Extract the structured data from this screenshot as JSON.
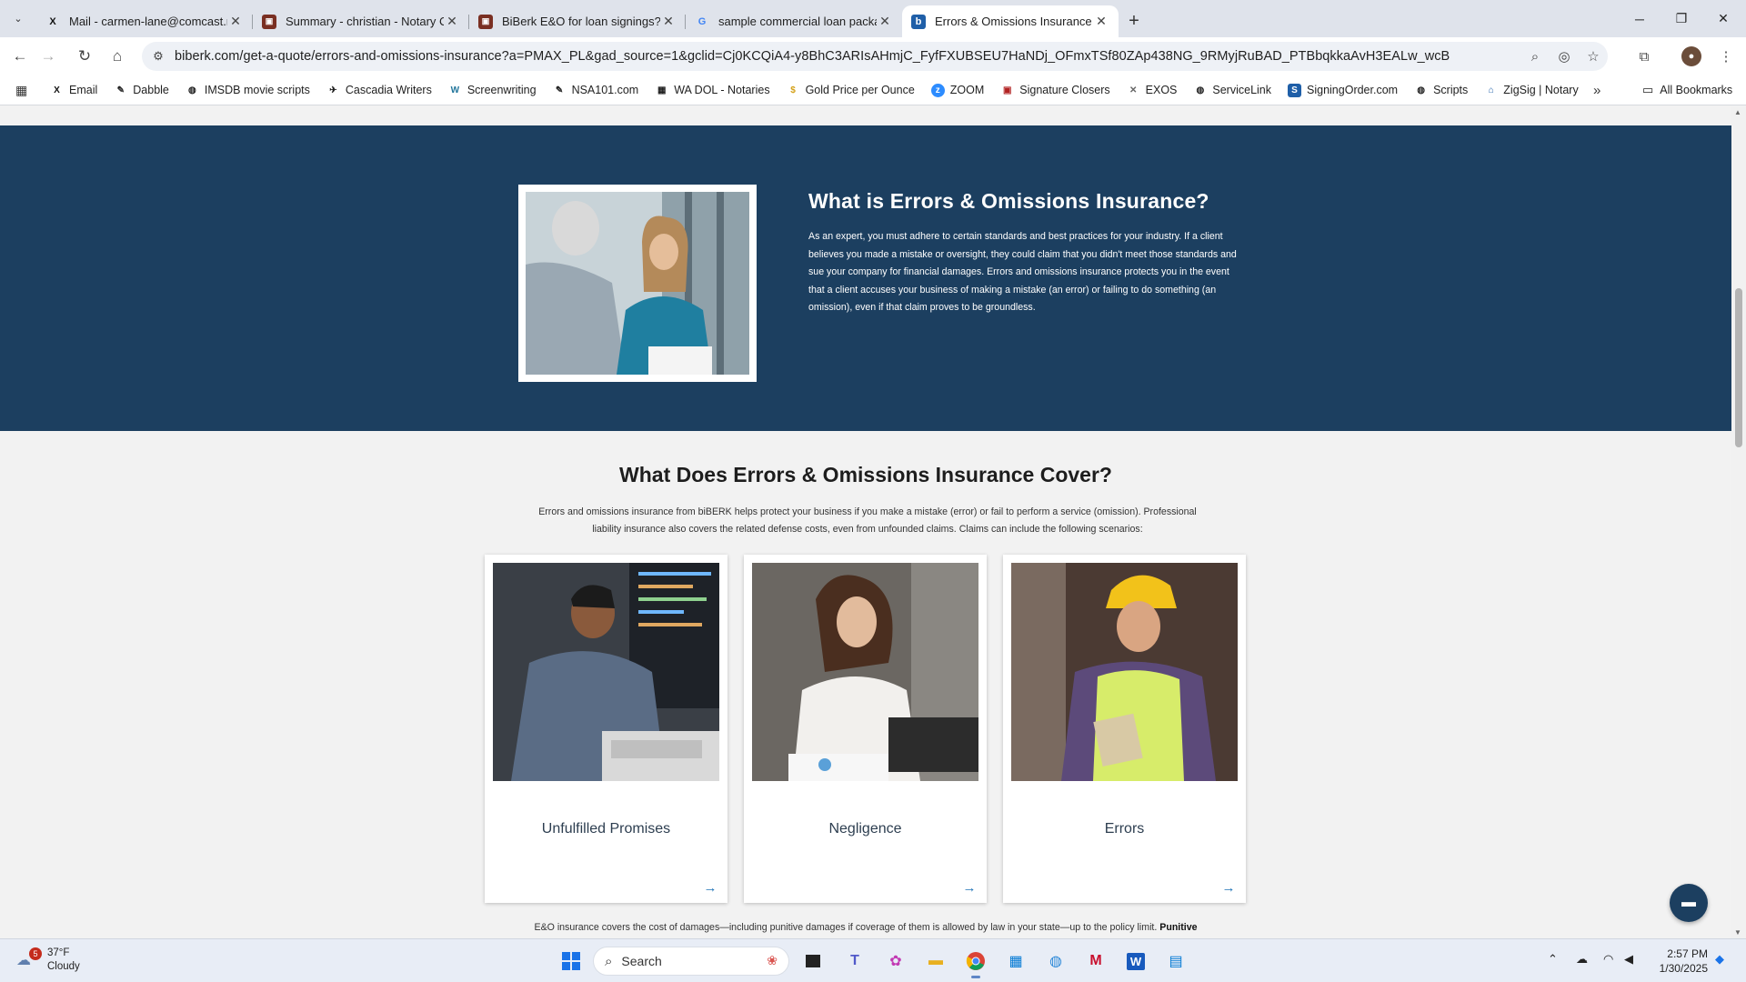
{
  "browser": {
    "tabs": [
      {
        "title": "Mail - carmen-lane@comcast.n",
        "favicon": "X",
        "fav_color": "#111111",
        "active": false
      },
      {
        "title": "Summary - christian - Notary C",
        "favicon": "▣",
        "fav_color": "#7a2f22",
        "active": false
      },
      {
        "title": "BiBerk E&O for loan signings? -",
        "favicon": "▣",
        "fav_color": "#7a2f22",
        "active": false
      },
      {
        "title": "sample commercial loan packa",
        "favicon": "G",
        "fav_color": "#4285f4",
        "active": false
      },
      {
        "title": "Errors & Omissions Insurance |",
        "favicon": "b",
        "fav_color": "#1f5fa8",
        "active": true
      }
    ],
    "new_tab_label": "+",
    "url": "biberk.com/get-a-quote/errors-and-omissions-insurance?a=PMAX_PL&gad_source=1&gclid=Cj0KCQiA4-y8BhC3ARIsAHmjC_FyfFXUBSEU7HaNDj_OFmxTSf80ZAp438NG_9RMyjRuBAD_PTBbqkkaAvH3EALw_wcB"
  },
  "bookmarks": {
    "items": [
      {
        "label": "Email",
        "icon": "X",
        "color": "#111111"
      },
      {
        "label": "Dabble",
        "icon": "✎",
        "color": "#333333"
      },
      {
        "label": "IMSDB movie scripts",
        "icon": "◍",
        "color": "#333333"
      },
      {
        "label": "Cascadia Writers",
        "icon": "✈",
        "color": "#333333"
      },
      {
        "label": "Screenwriting",
        "icon": "W",
        "color": "#21759b"
      },
      {
        "label": "NSA101.com",
        "icon": "✎",
        "color": "#333333"
      },
      {
        "label": "WA DOL - Notaries",
        "icon": "▦",
        "color": "#555555"
      },
      {
        "label": "Gold Price per Ounce",
        "icon": "$",
        "color": "#d4a017"
      },
      {
        "label": "ZOOM",
        "icon": "z",
        "color": "#2d8cff"
      },
      {
        "label": "Signature Closers",
        "icon": "▣",
        "color": "#b22222"
      },
      {
        "label": "EXOS",
        "icon": "✕",
        "color": "#666666"
      },
      {
        "label": "ServiceLink",
        "icon": "◍",
        "color": "#333333"
      },
      {
        "label": "SigningOrder.com",
        "icon": "S",
        "color": "#1f5fa8"
      },
      {
        "label": "Scripts",
        "icon": "◍",
        "color": "#333333"
      },
      {
        "label": "ZigSig | Notary",
        "icon": "⌂",
        "color": "#1f5fa8"
      }
    ],
    "more_label": "»",
    "all_bookmarks_label": "All Bookmarks"
  },
  "page": {
    "hero": {
      "title": "What is Errors & Omissions Insurance?",
      "body": "As an expert, you must adhere to certain standards and best practices for your industry. If a client believes you made a mistake or oversight, they could claim that you didn't meet those standards and sue your company for financial damages. Errors and omissions insurance protects you in the event that a client accuses your business of making a mistake (an error) or failing to do something (an omission), even if that claim proves to be groundless."
    },
    "cover": {
      "title": "What Does Errors & Omissions Insurance Cover?",
      "intro": "Errors and omissions insurance from biBERK helps protect your business if you make a mistake (error) or fail to perform a service (omission). Professional liability insurance also covers the related defense costs, even from unfounded claims. Claims can include the following scenarios:"
    },
    "cards": [
      {
        "label": "Unfulfilled Promises"
      },
      {
        "label": "Negligence"
      },
      {
        "label": "Errors"
      }
    ],
    "card_arrow": "→",
    "footnote": {
      "text": "E&O insurance covers the cost of damages—including punitive damages if coverage of them is allowed by law in your state—up to the policy limit.",
      "bold": "Punitive"
    }
  },
  "taskbar": {
    "weather": {
      "temp": "37°F",
      "condition": "Cloudy",
      "badge": "5"
    },
    "search_placeholder": "Search",
    "clock": {
      "time": "2:57 PM",
      "date": "1/30/2025"
    }
  },
  "colors": {
    "hero_bg": "#1c3f60",
    "accent": "#1f73b7"
  }
}
